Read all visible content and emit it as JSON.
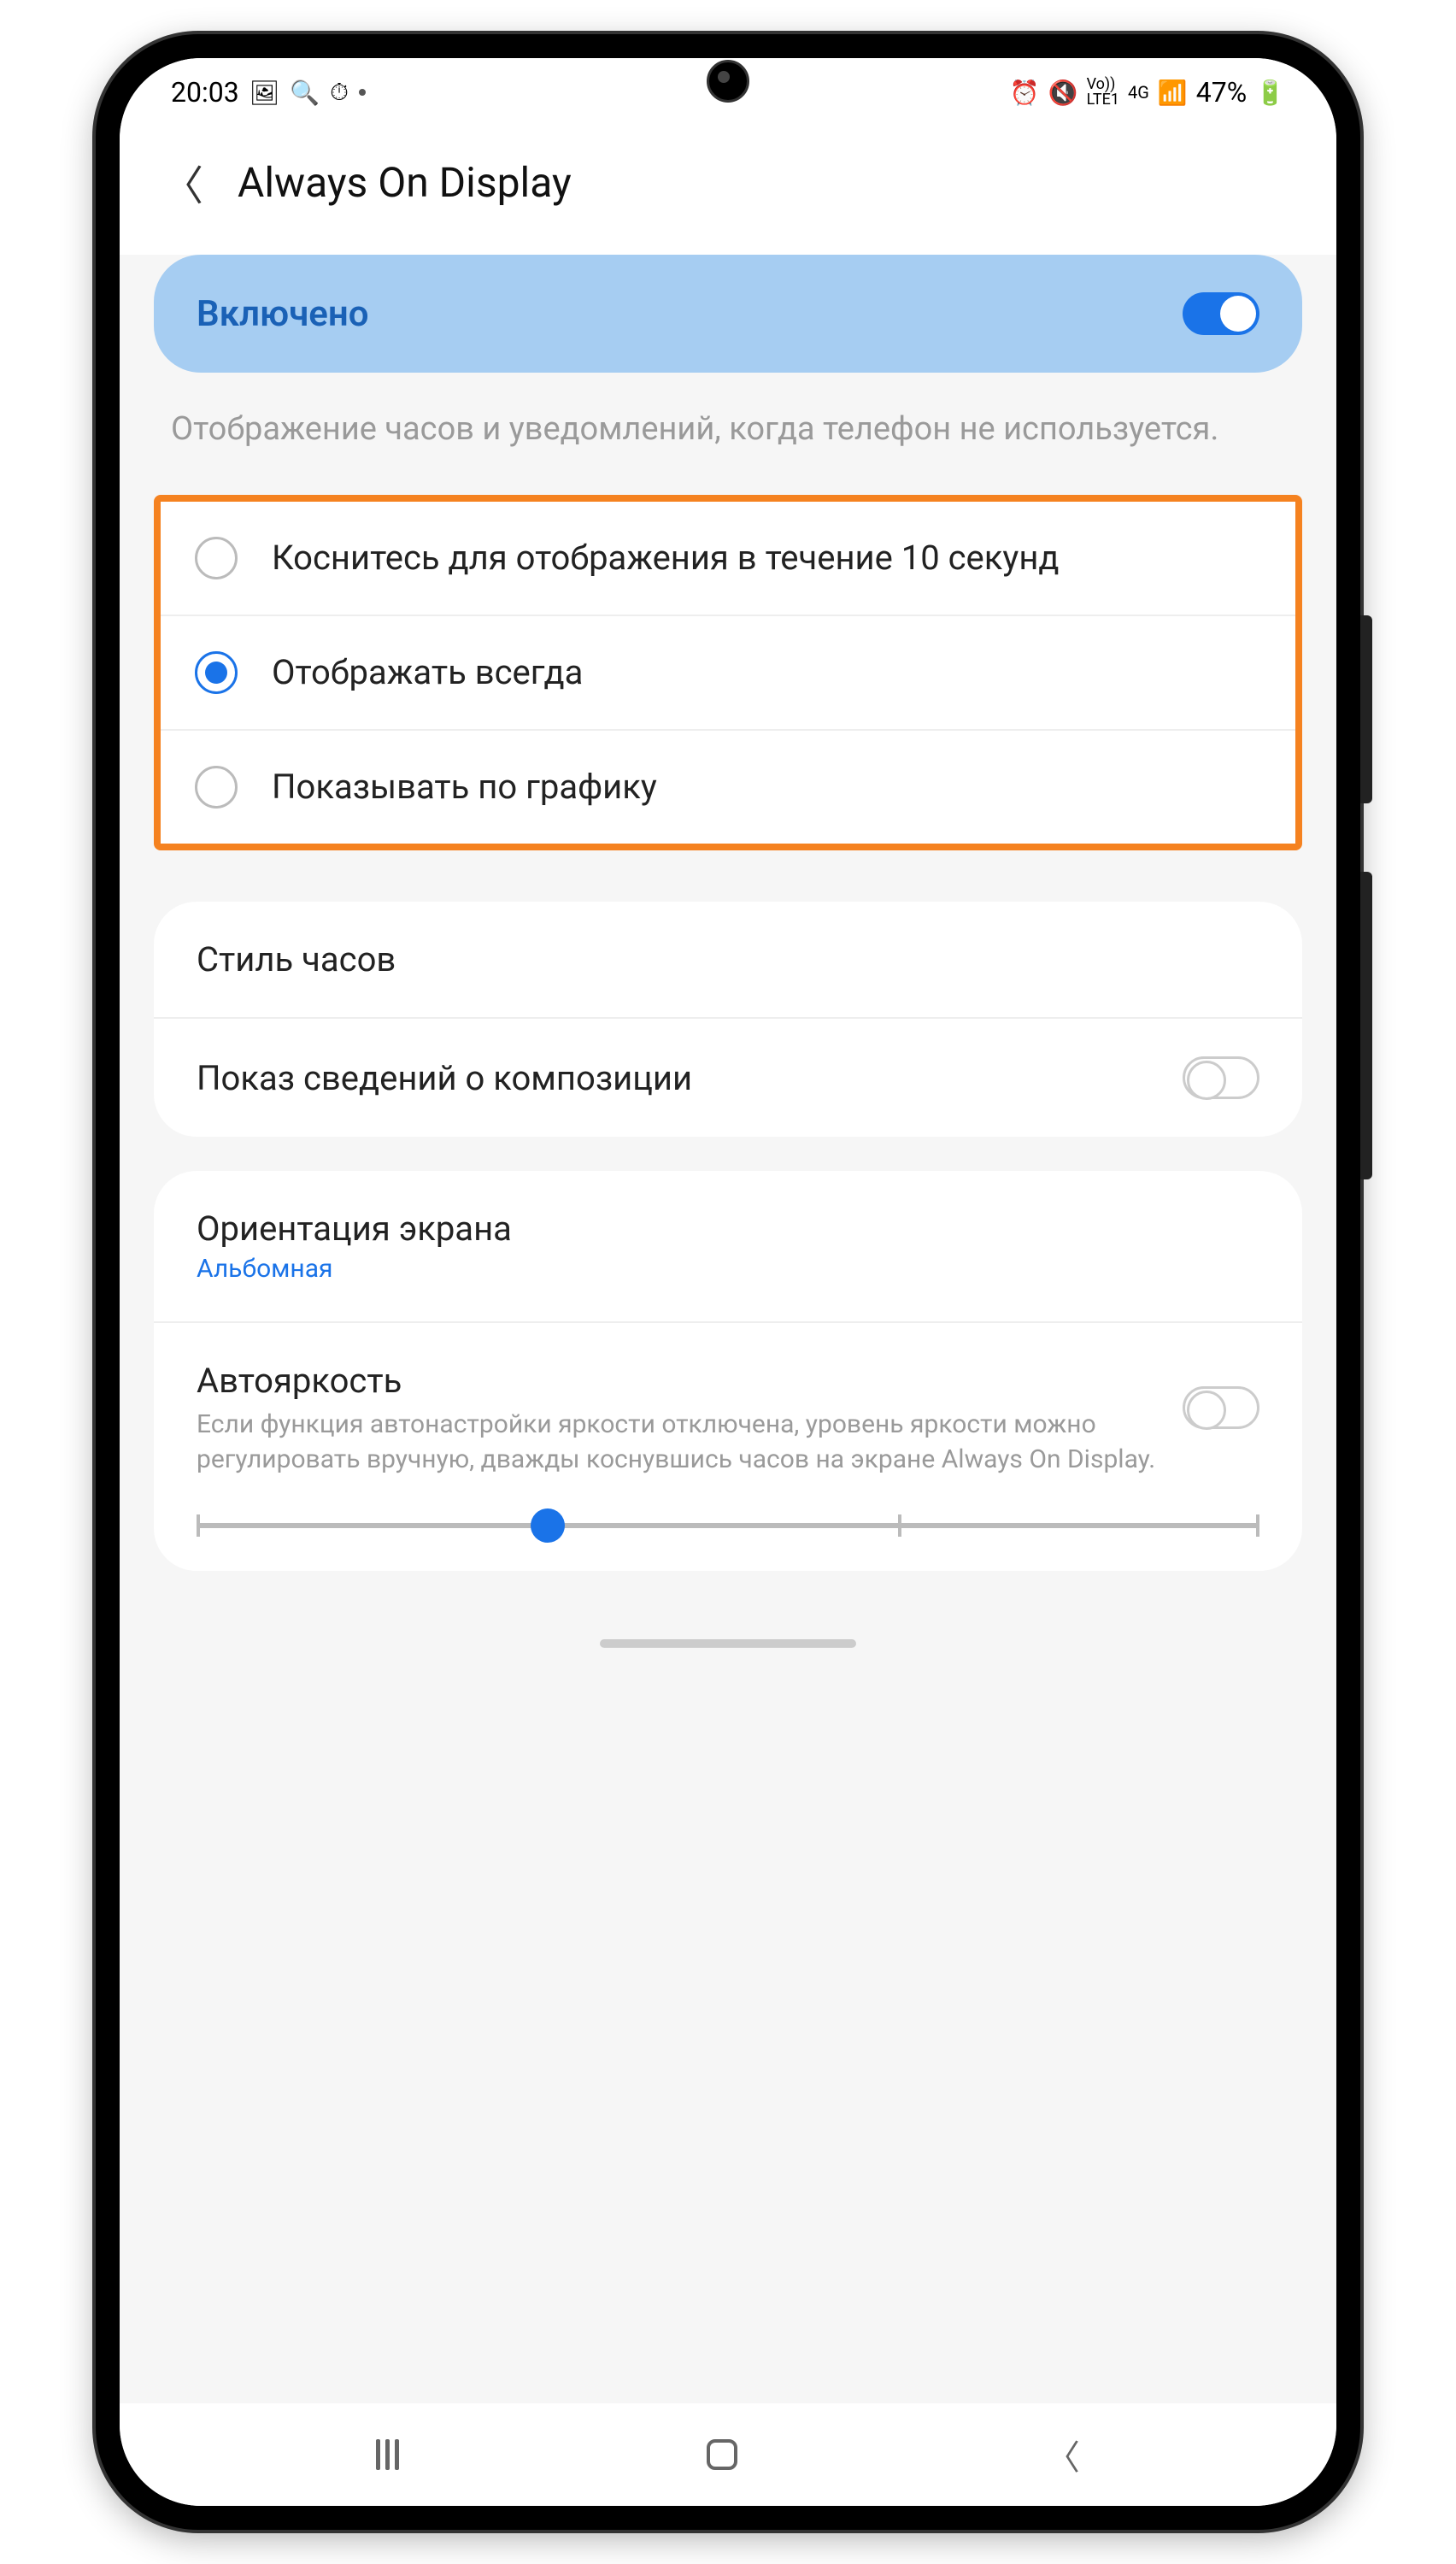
{
  "status": {
    "time": "20:03",
    "battery": "47%"
  },
  "header": {
    "title": "Always On Display"
  },
  "enable": {
    "label": "Включено",
    "on": true
  },
  "description": "Отображение часов и уведомлений, когда телефон не используется.",
  "radios": [
    {
      "label": "Коснитесь для отображения в течение 10 секунд",
      "selected": false
    },
    {
      "label": "Отображать всегда",
      "selected": true
    },
    {
      "label": "Показывать по графику",
      "selected": false
    }
  ],
  "settings1": {
    "clock_style": "Стиль часов",
    "composition": "Показ сведений о композиции"
  },
  "settings2": {
    "orientation_title": "Ориентация экрана",
    "orientation_value": "Альбомная",
    "brightness_title": "Автояркость",
    "brightness_desc": "Если функция автонастройки яркости отключена, уровень яркости можно регулировать вручную, дважды коснувшись часов на экране Always On Display.",
    "brightness_value_percent": 33
  }
}
